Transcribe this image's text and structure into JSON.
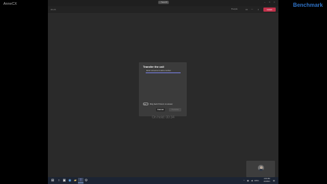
{
  "corner_label": "AnneCX",
  "watermark": "Benchmark",
  "titlebar": {
    "search_label": "Search"
  },
  "callbar": {
    "timer": "00:26",
    "people_label": "People",
    "leave_label": "Leave"
  },
  "dialog": {
    "title": "Transfer the call",
    "input_placeholder": "Enter someone to add a number",
    "toggle_label": "Ring back if there's no answer",
    "toggle_on": false,
    "cancel_label": "Cancel",
    "transfer_label": "Transfer"
  },
  "stage": {
    "status_text": "On hold: 00:34"
  },
  "taskbar": {
    "clock_time": "1:53 PM",
    "clock_date": "4/1/2021",
    "tray_lang": "ENG"
  }
}
